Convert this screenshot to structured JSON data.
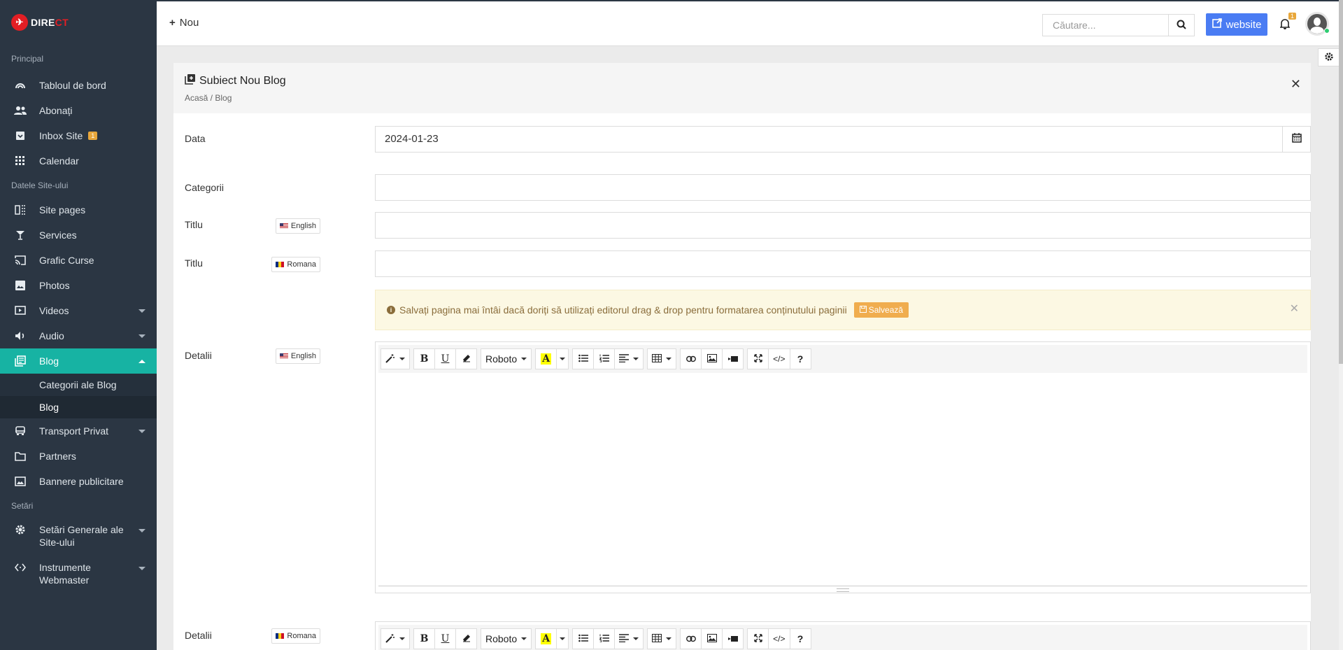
{
  "brand": {
    "logo_text_a": "DIRE",
    "logo_text_b": "CT"
  },
  "sidebar": {
    "sections": {
      "principal": "Principal",
      "site_data": "Datele Site-ului",
      "settings": "Setări"
    },
    "items": {
      "dashboard": "Tabloul de bord",
      "subscribers": "Abonați",
      "inbox": "Inbox Site",
      "inbox_badge": "1",
      "calendar": "Calendar",
      "site_pages": "Site pages",
      "services": "Services",
      "grafic": "Grafic Curse",
      "photos": "Photos",
      "videos": "Videos",
      "audio": "Audio",
      "blog": "Blog",
      "blog_categories": "Categorii ale Blog",
      "blog_sub": "Blog",
      "transport": "Transport Privat",
      "partners": "Partners",
      "banners": "Bannere publicitare",
      "general_settings": "Setări Generale ale Site-ului",
      "webmaster_tools": "Instrumente Webmaster"
    }
  },
  "topbar": {
    "new_label": "Nou",
    "search_placeholder": "Căutare...",
    "website_label": "website",
    "notif_count": "1"
  },
  "panel": {
    "title": "Subiect Nou Blog",
    "breadcrumb": "Acasă / Blog",
    "fields": {
      "date_label": "Data",
      "date_value": "2024-01-23",
      "categories_label": "Categorii",
      "title_label": "Titlu",
      "details_label": "Detalii"
    },
    "langs": {
      "en": "English",
      "ro": "Romana"
    },
    "alert": {
      "text": "Salvați pagina mai întâi dacă doriți să utilizați editorul drag & drop pentru formatarea conținutului paginii",
      "save_label": "Salvează"
    },
    "editor": {
      "font_name": "Roboto"
    }
  },
  "colors": {
    "sidebar": "#2b3643",
    "active": "#17b3a3",
    "website_btn": "#4a7cf3",
    "warning": "#f0ad4e"
  }
}
